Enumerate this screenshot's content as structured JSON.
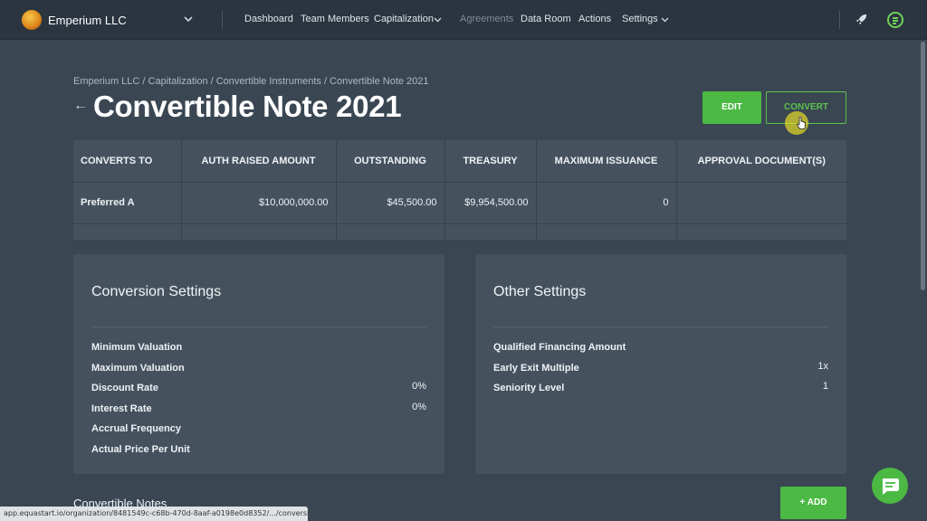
{
  "topbar": {
    "org_name": "Emperium LLC",
    "nav": {
      "dashboard": "Dashboard",
      "team_members": "Team Members",
      "capitalization": "Capitalization",
      "agreements": "Agreements",
      "data_room": "Data Room",
      "actions": "Actions",
      "settings": "Settings"
    },
    "accent_color": "#6fd05a"
  },
  "header": {
    "breadcrumb": "Emperium LLC / Capitalization / Convertible Instruments / Convertible Note 2021",
    "back_arrow": "←",
    "title": "Convertible Note 2021",
    "edit_label": "EDIT",
    "convert_label": "CONVERT"
  },
  "table": {
    "headers": {
      "converts_to": "CONVERTS TO",
      "auth_raised": "AUTH RAISED AMOUNT",
      "outstanding": "OUTSTANDING",
      "treasury": "TREASURY",
      "max_issuance": "MAXIMUM ISSUANCE",
      "approval_docs": "APPROVAL DOCUMENT(S)"
    },
    "row": {
      "converts_to": "Preferred A",
      "auth_raised": "$10,000,000.00",
      "outstanding": "$45,500.00",
      "treasury": "$9,954,500.00",
      "max_issuance": "0",
      "approval_docs": ""
    }
  },
  "conversion_settings": {
    "title": "Conversion Settings",
    "rows": {
      "min_valuation": {
        "label": "Minimum Valuation",
        "value": ""
      },
      "max_valuation": {
        "label": "Maximum Valuation",
        "value": ""
      },
      "discount_rate": {
        "label": "Discount Rate",
        "value": "0%"
      },
      "interest_rate": {
        "label": "Interest Rate",
        "value": "0%"
      },
      "accrual_frequency": {
        "label": "Accrual Frequency",
        "value": ""
      },
      "actual_price": {
        "label": "Actual Price Per Unit",
        "value": ""
      }
    }
  },
  "other_settings": {
    "title": "Other Settings",
    "rows": {
      "qualified_financing": {
        "label": "Qualified Financing Amount",
        "value": ""
      },
      "early_exit": {
        "label": "Early Exit Multiple",
        "value": "1x"
      },
      "seniority": {
        "label": "Seniority Level",
        "value": "1"
      }
    }
  },
  "convertible_notes": {
    "title": "Convertible Notes",
    "add_label": "+ ADD"
  },
  "status_url": "app.equastart.io/organization/8481549c-c68b-470d-8aaf-a0198e0d8352/.../conversion"
}
